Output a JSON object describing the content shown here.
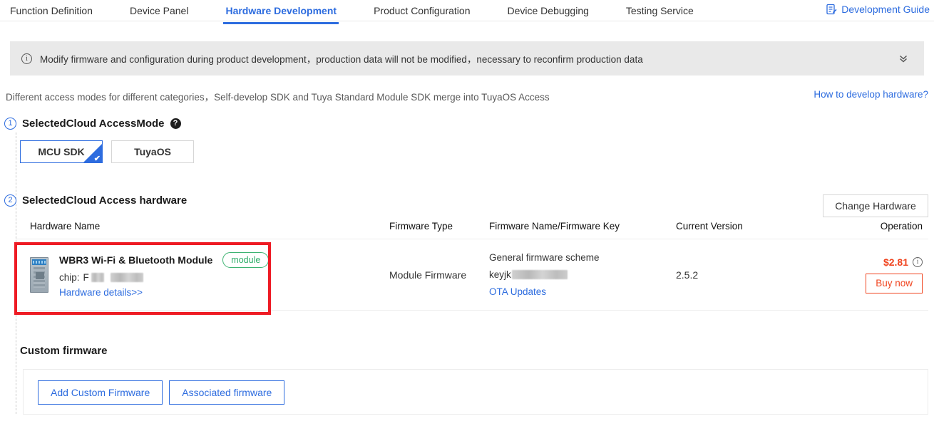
{
  "nav": {
    "tabs": [
      {
        "label": "Function Definition",
        "active": false
      },
      {
        "label": "Device Panel",
        "active": false
      },
      {
        "label": "Hardware Development",
        "active": true
      },
      {
        "label": "Product Configuration",
        "active": false
      },
      {
        "label": "Device Debugging",
        "active": false
      },
      {
        "label": "Testing Service",
        "active": false
      }
    ],
    "dev_guide_label": "Development Guide",
    "dev_guide_icon": "document-edit-icon"
  },
  "banner": {
    "icon": "info-circle-icon",
    "text": "Modify firmware and configuration during product development，production data will not be modified，necessary to reconfirm production data",
    "collapse_icon": "double-chevron-down-icon"
  },
  "subheader": {
    "description": "Different access modes for different categories，Self-develop SDK and Tuya Standard Module SDK merge into TuyaOS Access",
    "how_to_link": "How to develop hardware?"
  },
  "step1": {
    "number": "1",
    "title": "SelectedCloud AccessMode",
    "help_icon": "question-mark-icon",
    "modes": [
      {
        "label": "MCU SDK",
        "selected": true
      },
      {
        "label": "TuyaOS",
        "selected": false
      }
    ]
  },
  "step2": {
    "number": "2",
    "title": "SelectedCloud Access hardware",
    "change_hardware_label": "Change Hardware",
    "columns": [
      "Hardware Name",
      "Firmware Type",
      "Firmware Name/Firmware Key",
      "Current Version",
      "Operation"
    ],
    "row": {
      "thumbnail_icon": "wifi-module-thumbnail",
      "hardware_name": "WBR3 Wi-Fi & Bluetooth Module",
      "badge": "module",
      "chip_label": "chip:",
      "chip_value": "F",
      "chip_redacted": true,
      "details_link": "Hardware details>>",
      "firmware_type": "Module Firmware",
      "firmware_scheme": "General firmware scheme",
      "firmware_key_prefix": "keyjk",
      "firmware_key_redacted": true,
      "ota_link": "OTA Updates",
      "current_version": "2.5.2",
      "price": "$2.81",
      "price_info_icon": "info-circle-icon",
      "buy_label": "Buy now"
    }
  },
  "custom_firmware": {
    "title": "Custom firmware",
    "add_label": "Add Custom Firmware",
    "associated_label": "Associated firmware"
  },
  "colors": {
    "accent_blue": "#2d6cdf",
    "banner_bg": "#e9e9e9",
    "badge_green": "#2fae6a",
    "price_orange": "#f0441f",
    "annotation_red": "#ee1b24"
  }
}
